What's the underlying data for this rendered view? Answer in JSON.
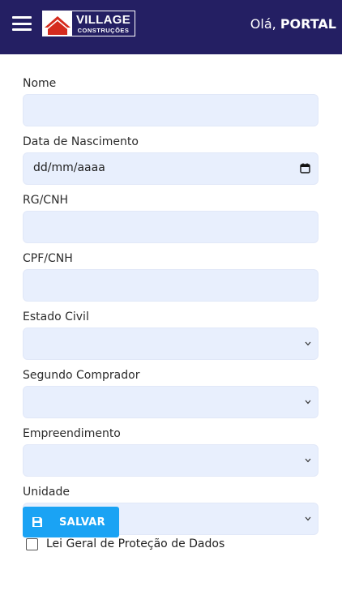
{
  "header": {
    "logo_title": "VILLAGE",
    "logo_subtitle": "CONSTRUÇÕES",
    "greeting_prefix": "Olá,",
    "greeting_name": "PORTAL"
  },
  "form": {
    "nome_label": "Nome",
    "data_nascimento_label": "Data de Nascimento",
    "data_nascimento_value": "dd/mm/aaaa",
    "rg_label": "RG/CNH",
    "cpf_label": "CPF/CNH",
    "estado_civil_label": "Estado Civil",
    "segundo_comprador_label": "Segundo Comprador",
    "empreendimento_label": "Empreendimento",
    "unidade_label": "Unidade",
    "lgpd_label": "Lei Geral de Proteção de Dados",
    "save_label": "SALVAR"
  },
  "colors": {
    "header_bg": "#241f63",
    "field_bg": "#e8effd",
    "button_bg": "#1aa3f4",
    "logo_red": "#d52b1e"
  },
  "icons": {
    "menu": "hamburger-menu-icon",
    "calendar": "calendar-icon",
    "dropdown": "chevron-down-icon",
    "save": "floppy-disk-icon"
  }
}
